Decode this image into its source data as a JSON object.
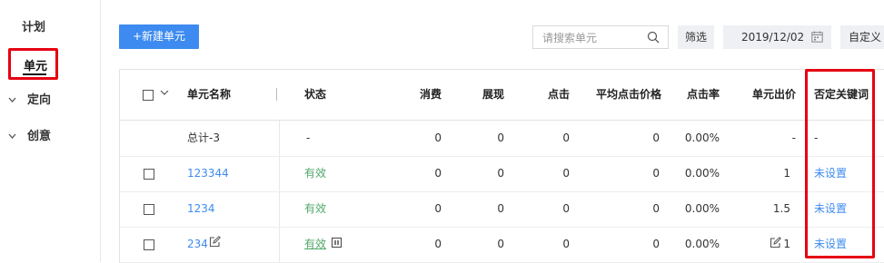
{
  "sidebar": {
    "items": [
      {
        "label": "计划"
      },
      {
        "label": "单元"
      },
      {
        "label": "定向"
      },
      {
        "label": "创意"
      }
    ]
  },
  "toolbar": {
    "new_unit_label": "+新建单元",
    "search_placeholder": "请搜索单元",
    "filter_label": "筛选",
    "date_value": "2019/12/02",
    "custom_label": "自定义"
  },
  "table": {
    "headers": {
      "name": "单元名称",
      "status": "状态",
      "cost": "消费",
      "impressions": "展现",
      "clicks": "点击",
      "avg_cpc": "平均点击价格",
      "ctr": "点击率",
      "bid": "单元出价",
      "negative_keywords": "否定关键词"
    },
    "total": {
      "name": "总计-3",
      "status": "-",
      "cost": "0",
      "impressions": "0",
      "clicks": "0",
      "avg_cpc": "0",
      "ctr": "0.00%",
      "bid": "-",
      "negative_keywords": "-"
    },
    "rows": [
      {
        "name": "123344",
        "status": "有效",
        "cost": "0",
        "impressions": "0",
        "clicks": "0",
        "avg_cpc": "0",
        "ctr": "0.00%",
        "bid": "1",
        "negative_keywords": "未设置"
      },
      {
        "name": "1234",
        "status": "有效",
        "cost": "0",
        "impressions": "0",
        "clicks": "0",
        "avg_cpc": "0",
        "ctr": "0.00%",
        "bid": "1.5",
        "negative_keywords": "未设置"
      },
      {
        "name": "234",
        "status": "有效",
        "cost": "0",
        "impressions": "0",
        "clicks": "0",
        "avg_cpc": "0",
        "ctr": "0.00%",
        "bid": "1",
        "negative_keywords": "未设置"
      }
    ]
  },
  "colors": {
    "accent": "#3d8bf0",
    "status_valid": "#52a86b",
    "highlight_box": "#e60012"
  },
  "icons": {
    "search": "search-icon",
    "calendar": "calendar-icon",
    "edit": "edit-icon",
    "pause": "pause-icon",
    "chevron": "chevron-down-icon"
  }
}
